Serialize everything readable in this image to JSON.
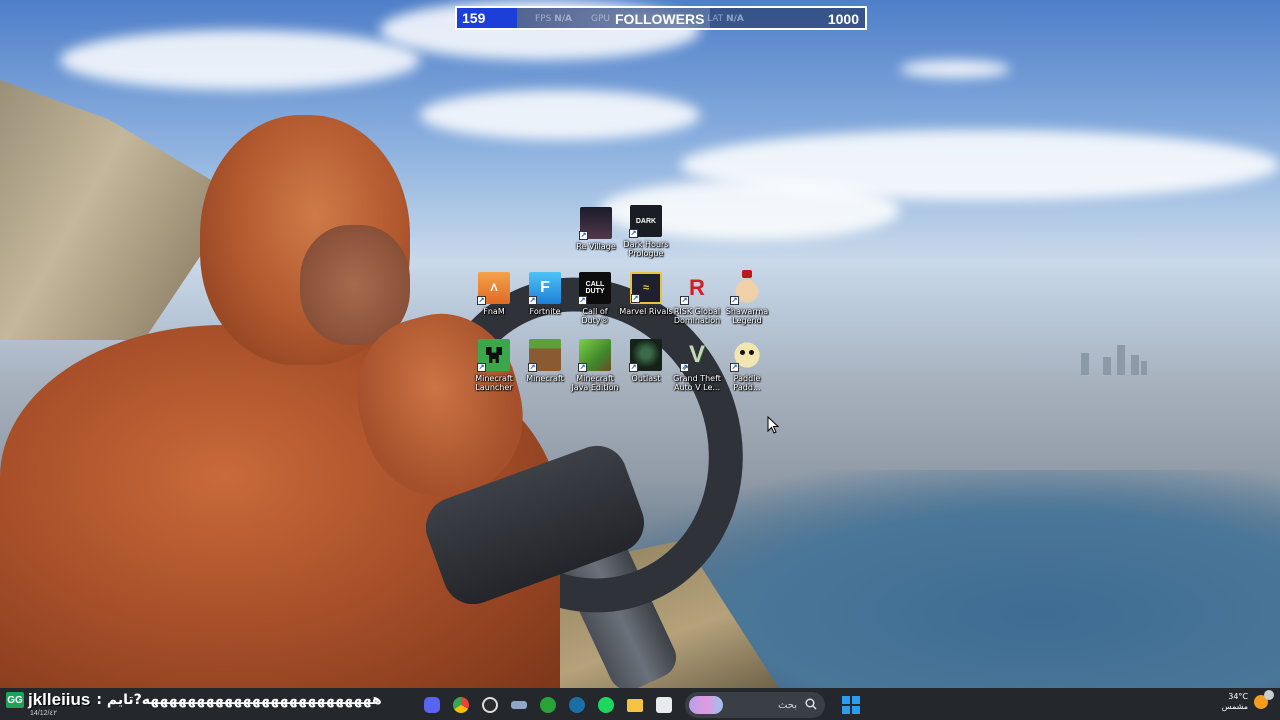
{
  "overlay": {
    "count": "159",
    "count_fraction": 0.159,
    "fps_label": "FPS",
    "fps_value": "N/A",
    "gpu_label": "GPU",
    "title": "FOLLOWERS",
    "lat_label": "LAT",
    "lat_value": "N/A",
    "goal": "1000"
  },
  "desktop_icons": {
    "re_village": "Re Village",
    "dark_hours": "Dark Hours Prologue",
    "fnaf": "FnaM",
    "fortnite": "Fortnite",
    "call_of_duty": "Call of Duty®",
    "marvel_rivals": "Marvel Rivals",
    "risk": "RISK Global Domination",
    "shawarma": "Shawarma Legend",
    "minecraft_launcher": "Minecraft Launcher",
    "minecraft": "Minecraft",
    "minecraft_java": "Minecraft Java Edition",
    "outlast": "Outlast",
    "gta": "Grand Theft Auto V Le...",
    "paddle": "Paddle Padd..."
  },
  "chat": {
    "badge": "GG",
    "username": "jklleiius",
    "message": ": هههههههههههههههههههههههههه?تايم",
    "date": "14/12/٤٢"
  },
  "taskbar": {
    "search_placeholder": "بحث",
    "temperature": "34°C",
    "weather": "مشمس",
    "apps": [
      "discord-icon",
      "chrome-icon",
      "obs-icon",
      "boat-icon",
      "xbox-icon",
      "steam-icon",
      "spotify-icon",
      "file-explorer-icon",
      "store-icon"
    ]
  },
  "colors": {
    "overlay_count_bg": "#1b3fd8",
    "taskbar_bg": "#24282c",
    "start_blue": "#2b9cf0",
    "chat_badge": "#1fa35a"
  }
}
